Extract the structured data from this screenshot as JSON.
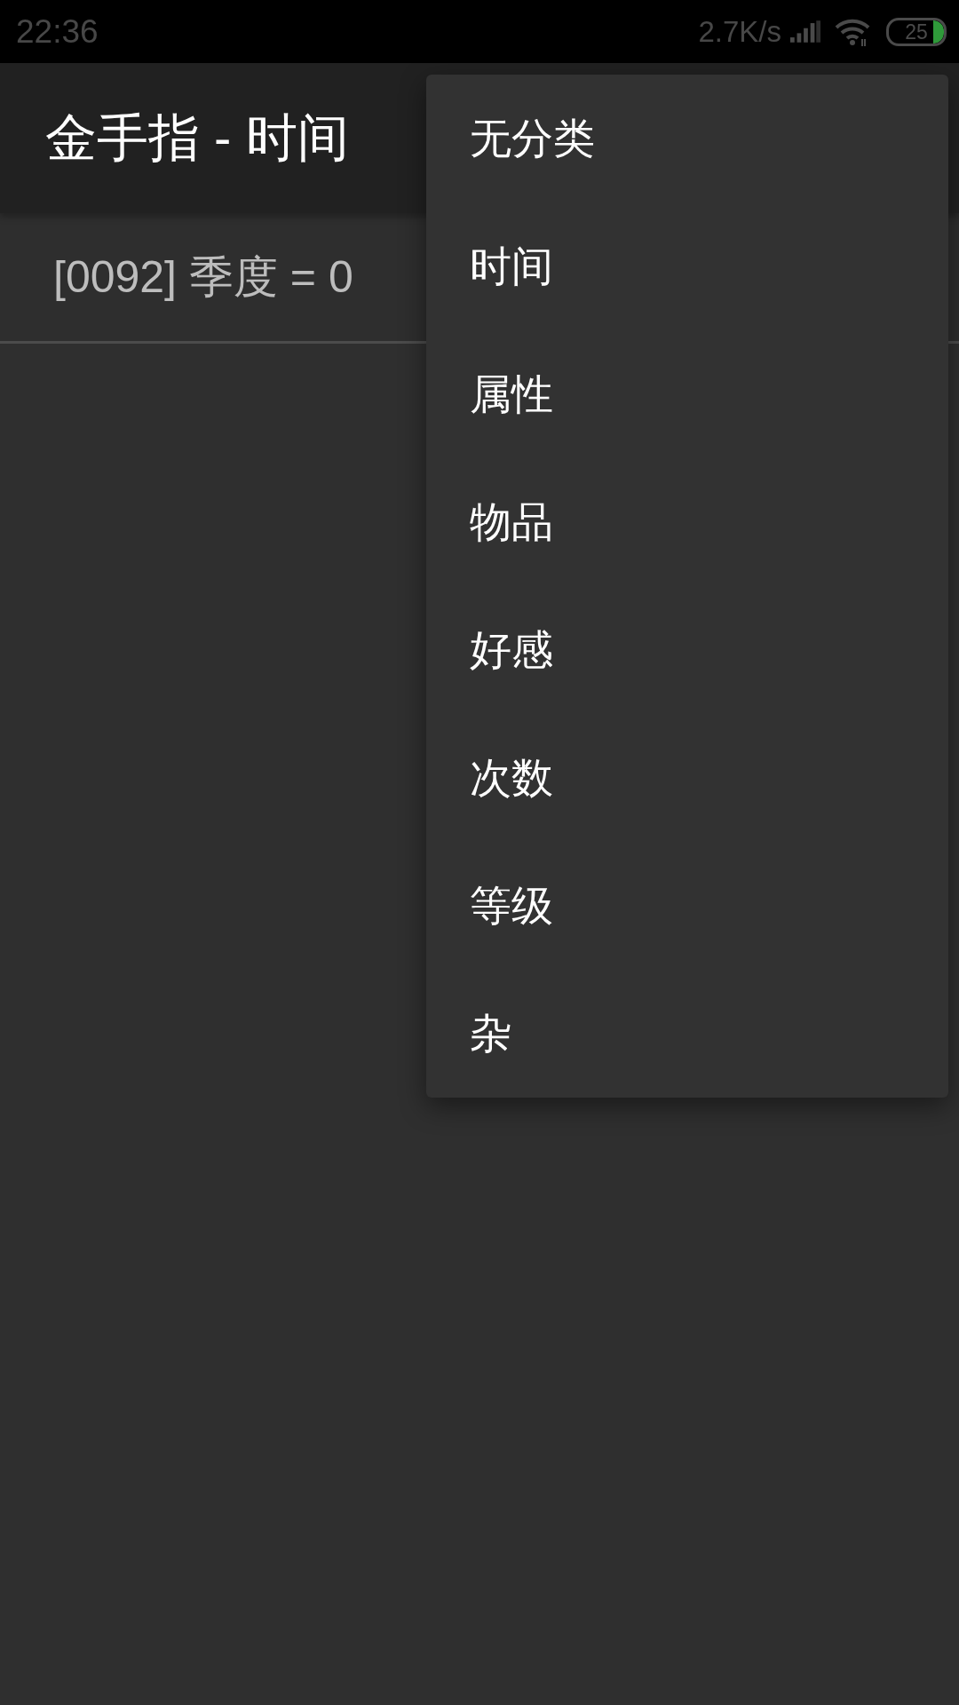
{
  "status_bar": {
    "time": "22:36",
    "network_speed": "2.7K/s",
    "battery": "25"
  },
  "toolbar": {
    "title": "金手指 - 时间"
  },
  "list": {
    "items": [
      {
        "text": "[0092] 季度 = 0"
      }
    ]
  },
  "menu": {
    "items": [
      {
        "label": "无分类"
      },
      {
        "label": "时间"
      },
      {
        "label": "属性"
      },
      {
        "label": "物品"
      },
      {
        "label": "好感"
      },
      {
        "label": "次数"
      },
      {
        "label": "等级"
      },
      {
        "label": "杂"
      }
    ]
  }
}
